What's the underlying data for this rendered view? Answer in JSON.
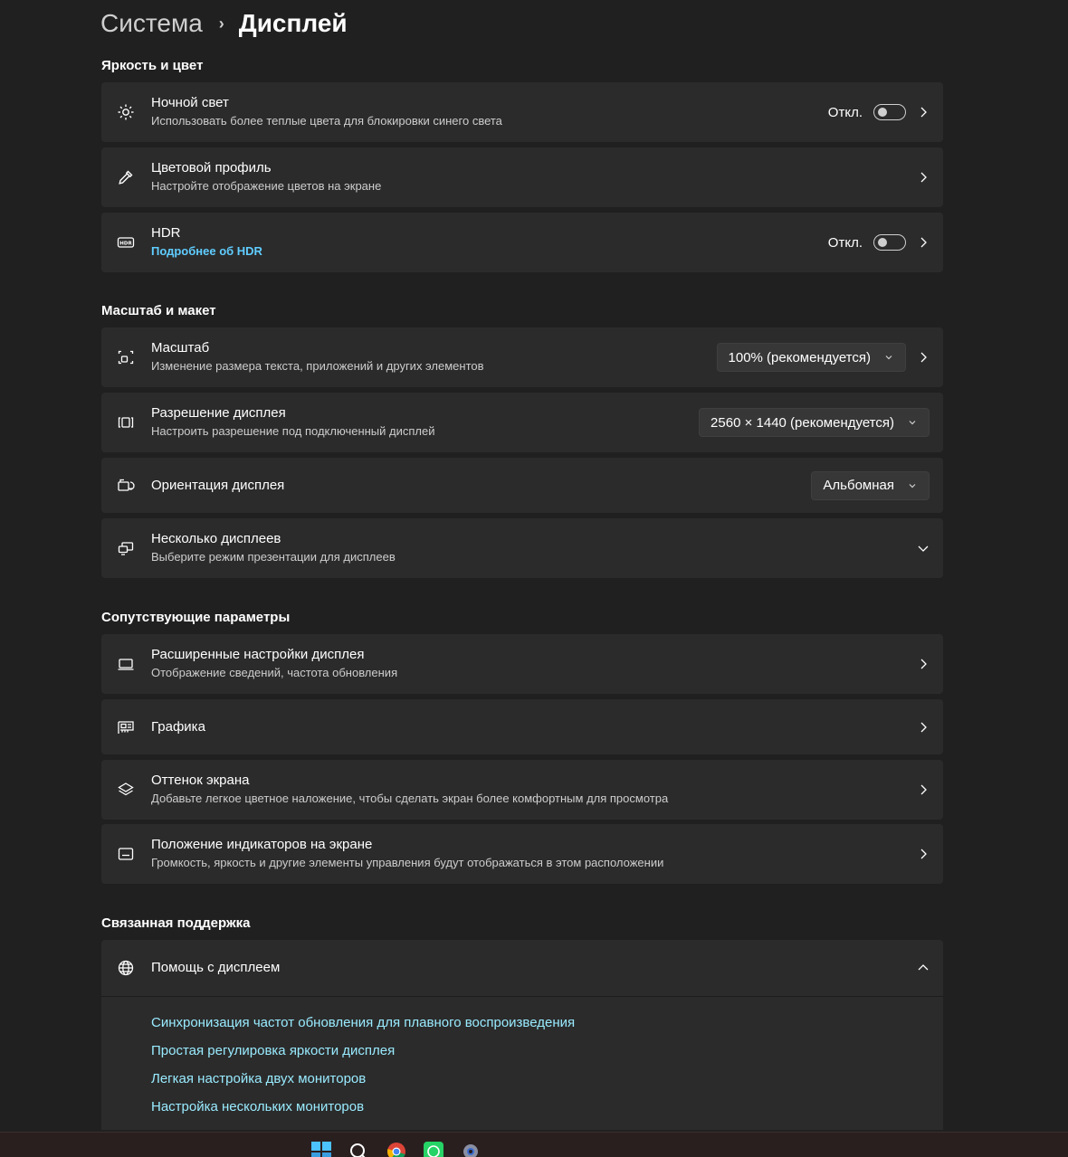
{
  "breadcrumb": {
    "parent": "Система",
    "separator": "›",
    "current": "Дисплей"
  },
  "sections": {
    "brightness": "Яркость и цвет",
    "scale_layout": "Масштаб и макет",
    "related_settings": "Сопутствующие параметры",
    "related_support": "Связанная поддержка"
  },
  "night_light": {
    "title": "Ночной свет",
    "subtitle": "Использовать более теплые цвета для блокировки синего света",
    "state": "Откл."
  },
  "color_profile": {
    "title": "Цветовой профиль",
    "subtitle": "Настройте отображение цветов на экране"
  },
  "hdr": {
    "title": "HDR",
    "link": "Подробнее об HDR",
    "state": "Откл."
  },
  "scale": {
    "title": "Масштаб",
    "subtitle": "Изменение размера текста, приложений и других элементов",
    "value": "100% (рекомендуется)"
  },
  "resolution": {
    "title": "Разрешение дисплея",
    "subtitle": "Настроить разрешение под подключенный дисплей",
    "value": "2560 × 1440 (рекомендуется)"
  },
  "orientation": {
    "title": "Ориентация дисплея",
    "value": "Альбомная"
  },
  "multiple_displays": {
    "title": "Несколько дисплеев",
    "subtitle": "Выберите режим презентации для дисплеев"
  },
  "advanced_display": {
    "title": "Расширенные настройки дисплея",
    "subtitle": "Отображение сведений, частота обновления"
  },
  "graphics": {
    "title": "Графика"
  },
  "screen_tint": {
    "title": "Оттенок экрана",
    "subtitle": "Добавьте легкое цветное наложение, чтобы сделать экран более комфортным для просмотра"
  },
  "indicator_position": {
    "title": "Положение индикаторов на экране",
    "subtitle": "Громкость, яркость и другие элементы управления будут отображаться в этом расположении"
  },
  "display_help": {
    "title": "Помощь с дисплеем",
    "links": [
      "Синхронизация частот обновления для плавного воспроизведения",
      "Простая регулировка яркости дисплея",
      "Легкая настройка двух мониторов",
      "Настройка нескольких мониторов"
    ]
  },
  "taskbar": {
    "icons": [
      "windows-start-icon",
      "search-icon",
      "chrome-icon",
      "whatsapp-icon",
      "settings-icon"
    ]
  },
  "colors": {
    "background": "#202020",
    "card": "#2b2b2b",
    "accent_link": "#60cdff",
    "help_link": "#99ebff"
  }
}
